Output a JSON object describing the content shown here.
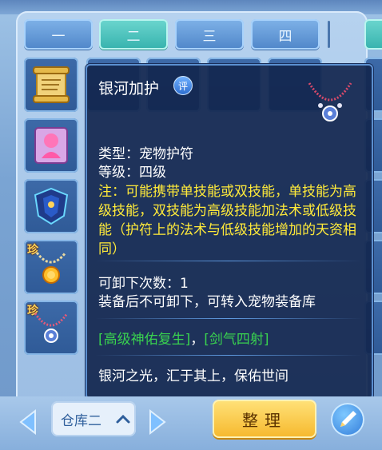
{
  "tabs": [
    {
      "label": "一",
      "active": false
    },
    {
      "label": "二",
      "active": true
    },
    {
      "label": "三",
      "active": false
    },
    {
      "label": "四",
      "active": false
    }
  ],
  "inventory": {
    "rare_badge": "珍",
    "items": [
      {
        "name": "scroll-icon"
      },
      {
        "name": "pet-card-icon"
      },
      {
        "name": "armor-icon"
      },
      {
        "name": "sun-necklace-icon",
        "rare": true
      },
      {
        "name": "galaxy-necklace-icon",
        "rare": true
      }
    ]
  },
  "tooltip": {
    "title": "银河加护",
    "badge": "评",
    "type_line": "类型：宠物护符",
    "level_line": "等级：四级",
    "note": "注：可能携带单技能或双技能，单技能为高级技能，双技能为高级技能加法术或低级技能（护符上的法术与低级技能增加的天资相同）",
    "unload_line": "可卸下次数：1",
    "equip_line": "装备后不可卸下，可转入宠物装备库",
    "skill_1": "[高级神佑复生]",
    "skill_sep": "，",
    "skill_2": "[剑气四射]",
    "flavor": "银河之光，汇于其上，保佑世间"
  },
  "bottom": {
    "storage_label": "仓库二",
    "arrange_label": "整理"
  },
  "colors": {
    "note_yellow": "#ffea3a",
    "skill_green": "#39d24f",
    "tooltip_bg": "#12264e",
    "arrange_gold": "#f6b82c"
  }
}
